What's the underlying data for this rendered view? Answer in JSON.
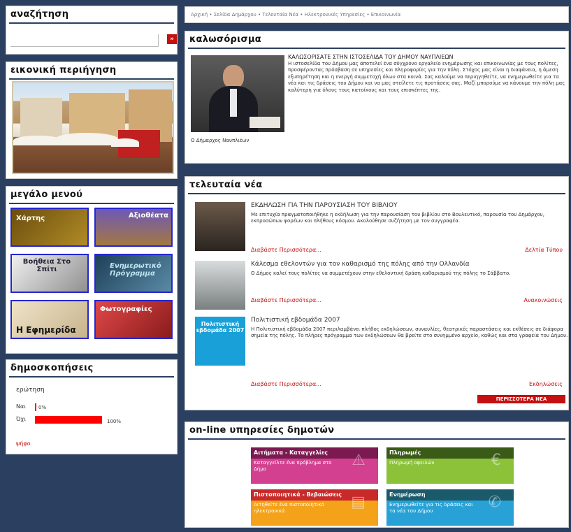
{
  "search": {
    "title": "αναζήτηση",
    "placeholder": "",
    "button": "»"
  },
  "tour": {
    "title": "εικονική περιήγηση"
  },
  "menu": {
    "title": "μεγάλο μενού",
    "tiles": [
      {
        "label": "Χάρτης",
        "color": "#8a6b14"
      },
      {
        "label": "Αξιοθέατα",
        "color": "#7a4a90"
      },
      {
        "label": "Βοήθεια Στο Σπίτι",
        "color": "#8a8a8a"
      },
      {
        "label": "Ενημερωτικό Πρόγραμμα",
        "color": "#3a6a88"
      },
      {
        "label": "Η Εφημερίδα",
        "color": "#e2d2b0"
      },
      {
        "label": "Φωτογραφίες",
        "color": "#c43434"
      }
    ]
  },
  "poll": {
    "title": "δημοσκοπήσεις",
    "question": "ερώτηση",
    "options": [
      {
        "label": "Ναι",
        "percent": 0,
        "pct_label": "0%"
      },
      {
        "label": "Όχι",
        "percent": 100,
        "pct_label": "100%"
      }
    ],
    "vote_link": "ψήφο"
  },
  "topbar": {
    "breadcrumb": "Αρχική • Σελίδα Δημάρχου • Τελευταία Νέα • Ηλεκτρονικές Υπηρεσίες • Επικοινωνία"
  },
  "mayor": {
    "title": "καλωσόρισμα",
    "headline": "ΚΑΛΩΣΟΡΙΣΑΤΕ ΣΤΗΝ ΙΣΤΟΣΕΛΙΔΑ ΤΟΥ ΔΗΜΟΥ ΝΑΥΠΛΙΕΩΝ",
    "body": "Η ιστοσελίδα του Δήμου μας αποτελεί ένα σύγχρονο εργαλείο ενημέρωσης και επικοινωνίας με τους πολίτες, προσφέροντας πρόσβαση σε υπηρεσίες και πληροφορίες για την πόλη. Στόχος μας είναι η διαφάνεια, η άμεση εξυπηρέτηση και η ενεργή συμμετοχή όλων στα κοινά. Σας καλούμε να περιηγηθείτε, να ενημερωθείτε για τα νέα και τις δράσεις του Δήμου και να μας στείλετε τις προτάσεις σας. Μαζί μπορούμε να κάνουμε την πόλη μας καλύτερη για όλους τους κατοίκους και τους επισκέπτες της.",
    "footer": "Ο Δήμαρχος Ναυπλιέων"
  },
  "news": {
    "title": "τελευταία νέα",
    "items": [
      {
        "title": "ΕΚΔΗΛΩΣΗ ΓΙΑ ΤΗΝ ΠΑΡΟΥΣΙΑΣΗ ΤΟΥ ΒΙΒΛΙΟΥ",
        "body": "Με επιτυχία πραγματοποιήθηκε η εκδήλωση για την παρουσίαση του βιβλίου στο Βουλευτικό, παρουσία του Δημάρχου, εκπροσώπων φορέων και πλήθους κόσμου. Ακολούθησε συζήτηση με τον συγγραφέα.",
        "more": "Διαβάστε Περισσότερα...",
        "category": "Δελτία Τύπου"
      },
      {
        "title": "Κάλεσμα εθελοντών για τον καθαρισμό της πόλης από την Ολλανδία",
        "body": "Ο Δήμος καλεί τους πολίτες να συμμετέχουν στην εθελοντική δράση καθαρισμού της πόλης το Σάββατο.",
        "more": "Διαβάστε Περισσότερα...",
        "category": "Ανακοινώσεις"
      },
      {
        "title": "Πολιτιστική εβδομάδα 2007",
        "body": "Η Πολιτιστική εβδομάδα 2007 περιλαμβάνει πλήθος εκδηλώσεων, συναυλίες, θεατρικές παραστάσεις και εκθέσεις σε διάφορα σημεία της πόλης. Το πλήρες πρόγραμμα των εκδηλώσεων θα βρείτε στο συνημμένο αρχείο, καθώς και στα γραφεία του Δήμου.",
        "more": "Διαβάστε Περισσότερα...",
        "category": "Εκδηλώσεις"
      }
    ],
    "more_button": "ΠΕΡΙΣΣΟΤΕΡΑ ΝΕΑ"
  },
  "services": {
    "title": "on-line υπηρεσίες δημοτών",
    "items": [
      {
        "title": "Αιτήματα - Καταγγελίες",
        "desc": "Καταγγείλτε ένα πρόβλημα στο Δήμο",
        "color": "#d2408f",
        "icon": "⚠"
      },
      {
        "title": "Πληρωμές",
        "desc": "Πληρωμή οφειλών",
        "color": "#8cc23a",
        "icon": "€"
      },
      {
        "title": "Πιστοποιητικά - Βεβαιώσεις",
        "desc": "Αιτηθείτε ένα πιστοποιητικό ηλεκτρονικά",
        "color": "#f3a21a",
        "icon": "▤"
      },
      {
        "title": "Ενημέρωση",
        "desc": "Ενημερωθείτε για τις δράσεις και τα νέα του Δήμου",
        "color": "#28a2d6",
        "icon": "✆"
      }
    ]
  }
}
